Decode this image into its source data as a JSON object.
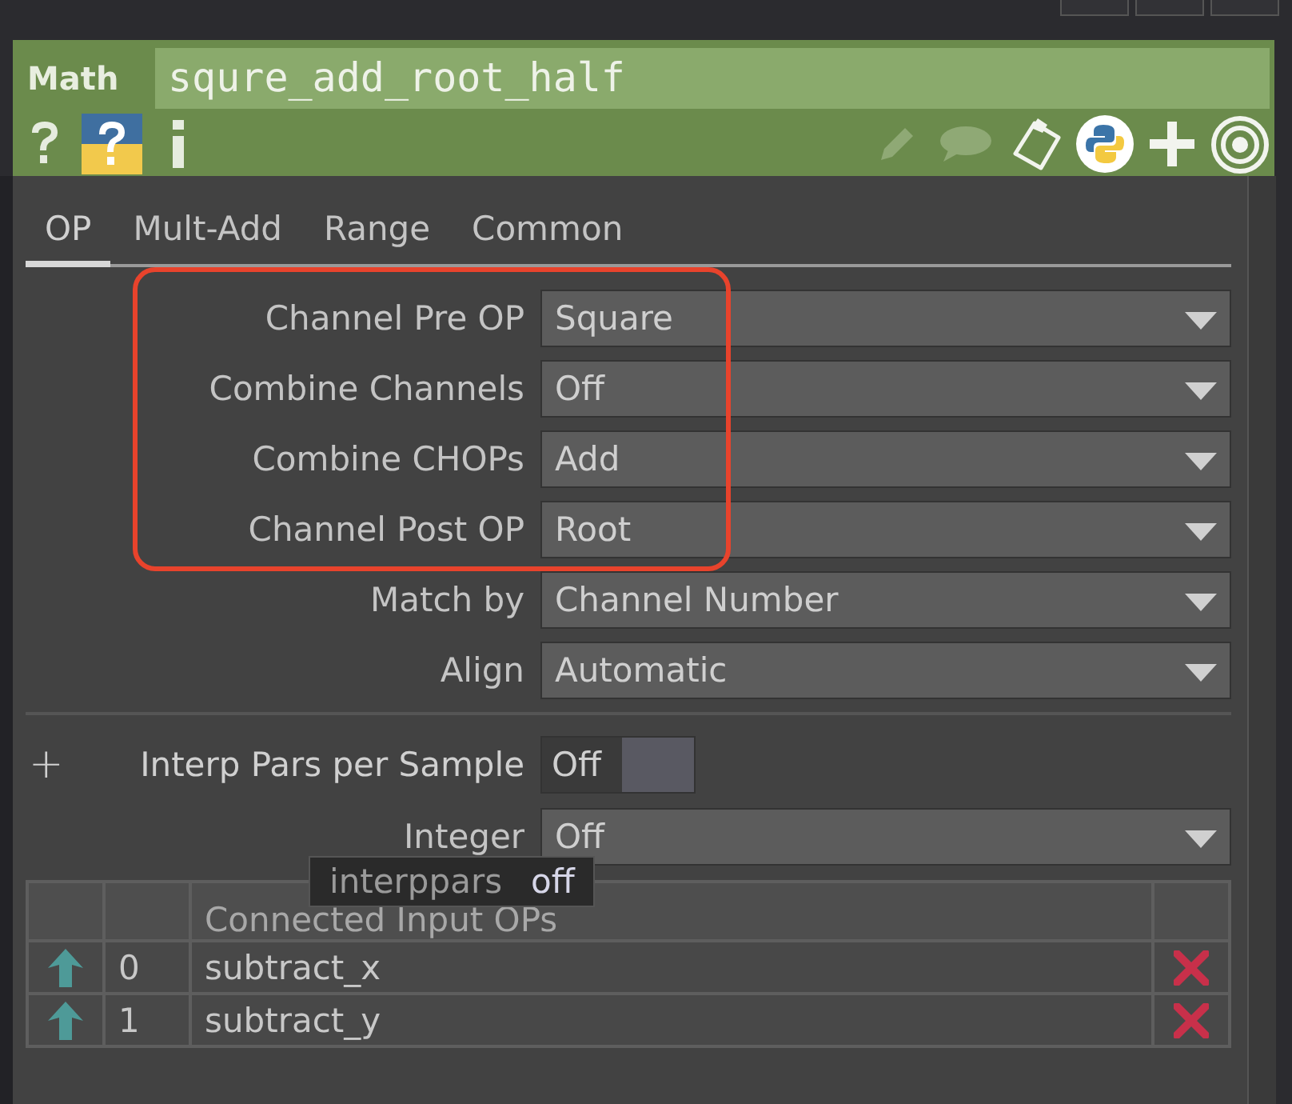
{
  "header": {
    "type_label": "Math",
    "name": "squre_add_root_half"
  },
  "tabs": [
    {
      "label": "OP",
      "selected": true
    },
    {
      "label": "Mult-Add",
      "selected": false
    },
    {
      "label": "Range",
      "selected": false
    },
    {
      "label": "Common",
      "selected": false
    }
  ],
  "menu_params": [
    {
      "label": "Channel Pre OP",
      "value": "Square",
      "highlighted": true
    },
    {
      "label": "Combine Channels",
      "value": "Off",
      "highlighted": true
    },
    {
      "label": "Combine CHOPs",
      "value": "Add",
      "highlighted": true
    },
    {
      "label": "Channel Post OP",
      "value": "Root",
      "highlighted": true
    },
    {
      "label": "Match by",
      "value": "Channel Number",
      "highlighted": false
    },
    {
      "label": "Align",
      "value": "Automatic",
      "highlighted": false
    }
  ],
  "toggle_param": {
    "expander": "+",
    "label": "Interp Pars per Sample",
    "value": "Off",
    "on": false
  },
  "integer_param": {
    "label": "Integer",
    "value": "Off"
  },
  "tooltip": {
    "name": "interppars",
    "value": "off"
  },
  "inputs_table": {
    "column": "Connected Input OPs",
    "rows": [
      {
        "index": "0",
        "name": "subtract_x"
      },
      {
        "index": "1",
        "name": "subtract_y"
      }
    ]
  }
}
